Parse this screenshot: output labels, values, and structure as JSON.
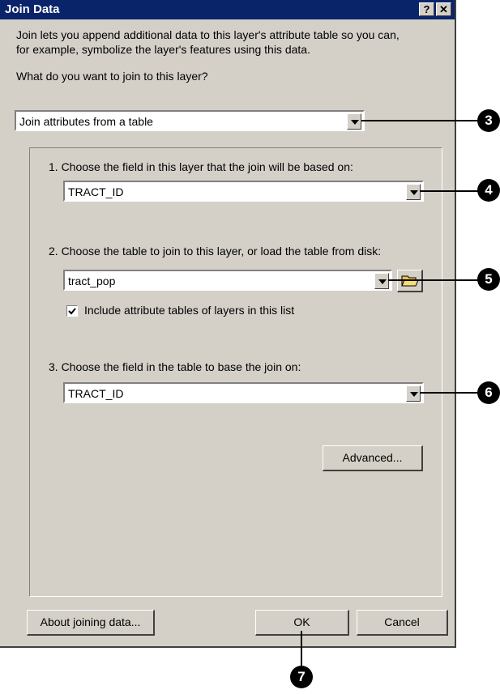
{
  "window": {
    "title": "Join Data",
    "help_label": "?",
    "close_label": "✕"
  },
  "intro": {
    "line1": "Join lets you append additional data to this layer's attribute table so you can,",
    "line2": "for example, symbolize the layer's features using this data."
  },
  "join_type": {
    "question": "What do you want to join to this layer?",
    "selected": "Join attributes from a table"
  },
  "step1": {
    "label": "1.  Choose the field in this layer that the join will be based on:",
    "selected": "TRACT_ID"
  },
  "step2": {
    "label": "2.  Choose the table to join to this layer, or load the table from disk:",
    "selected": "tract_pop",
    "checkbox_label": "Include attribute tables of layers in this list",
    "checkbox_checked": true
  },
  "step3": {
    "label": "3.  Choose the field in the table to base the join on:",
    "selected": "TRACT_ID"
  },
  "buttons": {
    "advanced": "Advanced...",
    "about": "About joining data...",
    "ok": "OK",
    "cancel": "Cancel"
  },
  "callouts": [
    "3",
    "4",
    "5",
    "6",
    "7"
  ]
}
